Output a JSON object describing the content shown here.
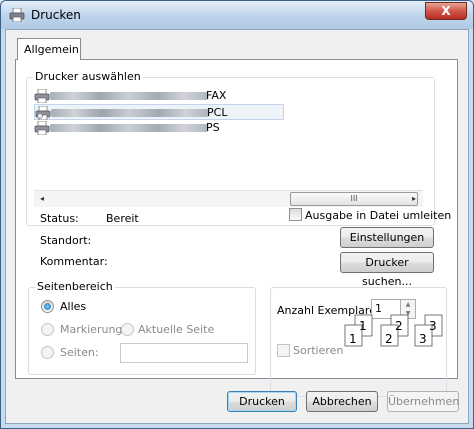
{
  "window": {
    "title": "Drucken",
    "close_symbol": "X"
  },
  "tabs": [
    {
      "label": "Allgemein"
    }
  ],
  "printer_group": {
    "label": "Drucker auswählen",
    "printers": [
      {
        "suffix": "FAX"
      },
      {
        "suffix": "PCL"
      },
      {
        "suffix": "PS"
      }
    ]
  },
  "scrollbar": {
    "left_arrow": "◂",
    "right_arrow": "▸",
    "grip": "III"
  },
  "info": {
    "status_label": "Status:",
    "status_value": "Bereit",
    "location_label": "Standort:",
    "comment_label": "Kommentar:",
    "print_to_file_label": "Ausgabe in Datei umleiten",
    "settings_button": "Einstellungen",
    "find_printer_button": "Drucker suchen..."
  },
  "page_range": {
    "label": "Seitenbereich",
    "all": "Alles",
    "selection": "Markierung",
    "current_page": "Aktuelle Seite",
    "pages": "Seiten:",
    "pages_value": ""
  },
  "copies": {
    "label": "Anzahl Exemplare:",
    "value": "1",
    "collate_label": "Sortieren",
    "collate_pages": [
      "1",
      "1",
      "2",
      "2",
      "3",
      "3"
    ]
  },
  "buttons": {
    "print": "Drucken",
    "cancel": "Abbrechen",
    "apply": "Übernehmen"
  }
}
